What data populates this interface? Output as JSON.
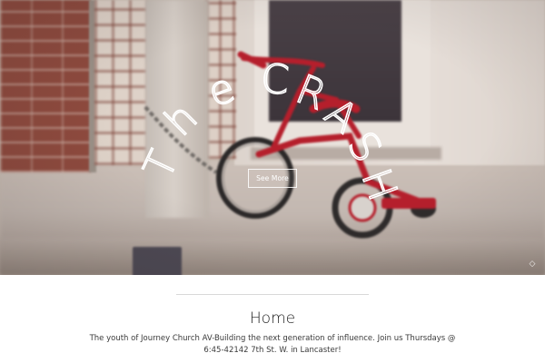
{
  "hero": {
    "title_letters": [
      "T",
      "h",
      "e",
      " ",
      "C",
      "R",
      "A",
      "S",
      "H"
    ],
    "see_more_label": "See More",
    "next_arrow_glyph": "◇",
    "colors": {
      "title_stroke": "#ffffff",
      "tricycle_red": "#b51f2c"
    }
  },
  "page": {
    "title": "Home",
    "intro": "The youth of Journey Church AV-Building the next generation of influence. Join us Thursdays @ 6:45-42142 7th St. W. in Lancaster!"
  }
}
